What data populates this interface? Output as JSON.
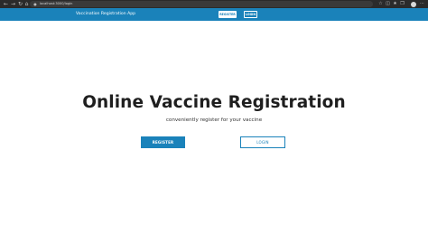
{
  "browser": {
    "url": "localhost:3000/login",
    "icons": [
      "back-icon",
      "forward-icon",
      "reload-icon",
      "home-icon",
      "lock-icon",
      "star-icon",
      "split-screen-icon",
      "favorites-icon",
      "collections-icon",
      "profile-icon",
      "more-icon"
    ]
  },
  "app_nav": {
    "title": "Vaccination Registration App",
    "register_label": "REGISTER",
    "login_label": "LOGIN"
  },
  "hero": {
    "title": "Online Vaccine Registration",
    "subtitle": "conveniently register for your vaccine",
    "register_label": "REGISTER",
    "login_label": "LOGIN"
  },
  "colors": {
    "primary": "#1a82ba",
    "browser_chrome": "#2b2b2b",
    "text": "#1f1f1f"
  }
}
